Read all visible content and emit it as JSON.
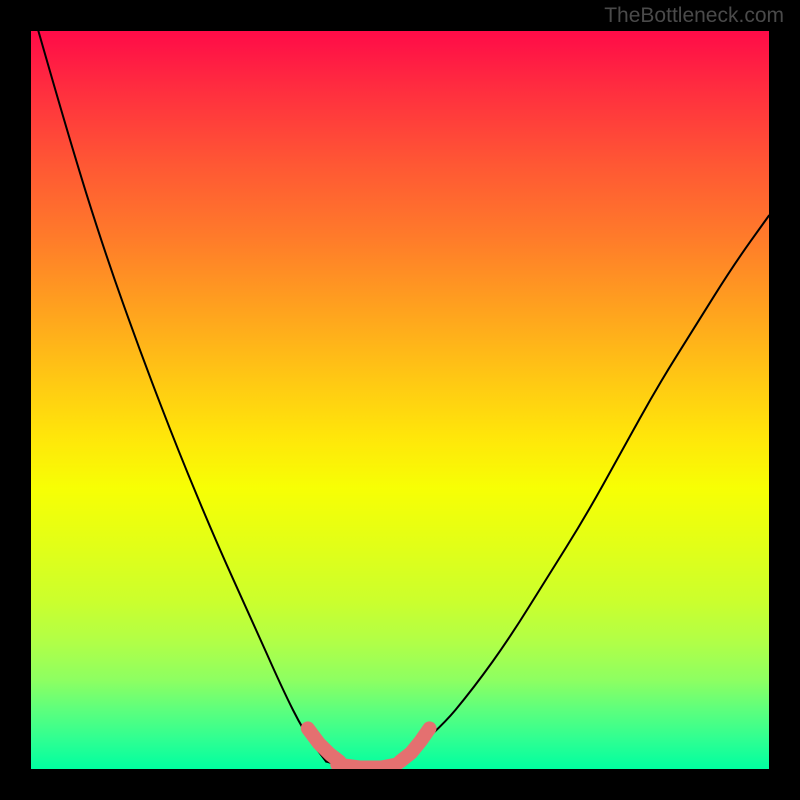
{
  "watermark": "TheBottleneck.com",
  "chart_data": {
    "type": "line",
    "title": "",
    "xlabel": "",
    "ylabel": "",
    "xlim": [
      0,
      1
    ],
    "ylim": [
      0,
      1
    ],
    "left_curve": {
      "x": [
        0.01,
        0.05,
        0.1,
        0.15,
        0.2,
        0.25,
        0.3,
        0.34,
        0.37,
        0.4
      ],
      "y": [
        1.0,
        0.86,
        0.7,
        0.56,
        0.43,
        0.31,
        0.2,
        0.11,
        0.05,
        0.01
      ]
    },
    "dip_curve": {
      "x": [
        0.4,
        0.42,
        0.45,
        0.48,
        0.5
      ],
      "y": [
        0.01,
        0.004,
        0.002,
        0.004,
        0.01
      ]
    },
    "right_curve": {
      "x": [
        0.5,
        0.55,
        0.6,
        0.65,
        0.7,
        0.75,
        0.8,
        0.85,
        0.9,
        0.95,
        1.0
      ],
      "y": [
        0.01,
        0.05,
        0.11,
        0.18,
        0.26,
        0.34,
        0.43,
        0.52,
        0.6,
        0.68,
        0.75
      ]
    },
    "highlight_left": {
      "x": [
        0.375,
        0.39,
        0.405,
        0.418
      ],
      "y": [
        0.055,
        0.035,
        0.02,
        0.01
      ]
    },
    "highlight_bottom": {
      "x": [
        0.415,
        0.445,
        0.475,
        0.495
      ],
      "y": [
        0.006,
        0.002,
        0.002,
        0.006
      ]
    },
    "highlight_right": {
      "x": [
        0.5,
        0.515,
        0.528,
        0.54
      ],
      "y": [
        0.01,
        0.022,
        0.038,
        0.055
      ]
    },
    "colors": {
      "curve": "#000000",
      "highlight": "#e47070"
    }
  }
}
